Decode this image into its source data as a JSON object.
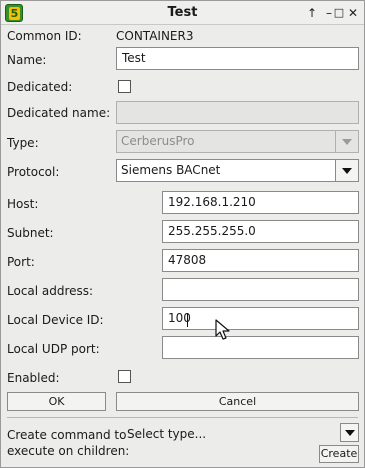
{
  "window": {
    "title": "Test"
  },
  "titlebar_buttons": {
    "maximize": "↑",
    "minimize": "–",
    "restore": "□",
    "close": "✕"
  },
  "form": {
    "common_id_label": "Common ID:",
    "common_id_value": "CONTAINER3",
    "name_label": "Name:",
    "name_value": "Test",
    "dedicated_label": "Dedicated:",
    "dedicated_checked": false,
    "dedicated_name_label": "Dedicated name:",
    "dedicated_name_value": "",
    "type_label": "Type:",
    "type_value": "CerberusPro",
    "protocol_label": "Protocol:",
    "protocol_value": "Siemens BACnet",
    "host_label": "Host:",
    "host_value": "192.168.1.210",
    "subnet_label": "Subnet:",
    "subnet_value": "255.255.255.0",
    "port_label": "Port:",
    "port_value": "47808",
    "local_address_label": "Local address:",
    "local_address_value": "",
    "local_device_id_label": "Local Device ID:",
    "local_device_id_value": "100",
    "local_udp_port_label": "Local UDP port:",
    "local_udp_port_value": "",
    "enabled_label": "Enabled:",
    "enabled_checked": false
  },
  "buttons": {
    "ok": "OK",
    "cancel": "Cancel",
    "create": "Create"
  },
  "children_command": {
    "label_line1": "Create command to",
    "label_line2": "execute on children:",
    "select_value": "Select type..."
  },
  "icons": {
    "app": "5"
  }
}
